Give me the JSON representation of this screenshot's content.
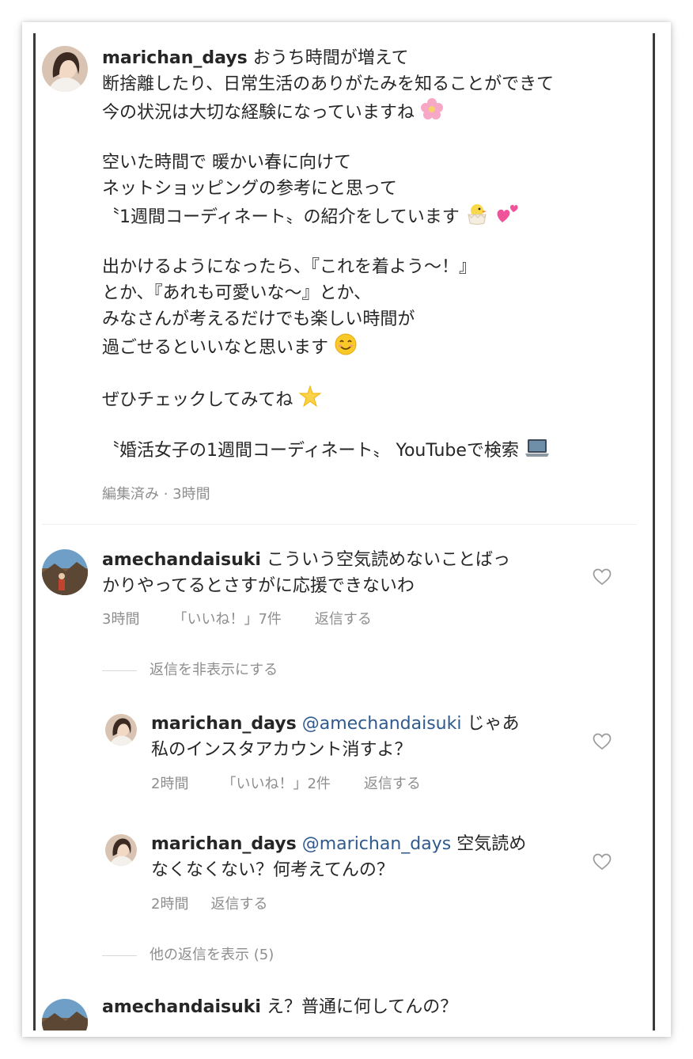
{
  "post": {
    "username": "marichan_days",
    "lines": [
      "おうち時間が増えて",
      "断捨離したり、日常生活のありがたみを知ることができて",
      "今の状況は大切な経験になっていますね",
      "",
      "空いた時間で 暖かい春に向けて",
      "ネットショッピングの参考にと思って",
      "〝1週間コーディネート〟の紹介をしています",
      "",
      "出かけるようになったら、『これを着よう〜！』",
      "とか、『あれも可愛いな〜』とか、",
      "みなさんが考えるだけでも楽しい時間が",
      "過ごせるといいなと思います",
      "",
      "ぜひチェックしてみてね",
      "",
      " 〝婚活女子の1週間コーディネート〟 YouTubeで検索"
    ],
    "meta": "編集済み · 3時間"
  },
  "comment1": {
    "username": "amechandaisuki",
    "line1": "こういう空気読めないことばっ",
    "line2": "かりやってるとさすがに応援できないわ",
    "time": "3時間",
    "likes": "「いいね！」7件",
    "reply": "返信する"
  },
  "hide_replies": "返信を非表示にする",
  "reply1": {
    "username": "marichan_days",
    "mention": "@amechandaisuki",
    "line1_rest": " じゃあ",
    "line2": "私のインスタアカウント消すよ？",
    "time": "2時間",
    "likes": "「いいね！」2件",
    "reply": "返信する"
  },
  "reply2": {
    "username": "marichan_days",
    "mention": "@marichan_days",
    "line1_rest": " 空気読め",
    "line2": "なくなくない？何考えてんの？",
    "time": "2時間",
    "reply": "返信する"
  },
  "more_replies": "他の返信を表示 (5)",
  "comment2": {
    "username": "amechandaisuki",
    "line1": "え？普通に何してんの？"
  },
  "icons": {
    "heart": "heart-outline-icon",
    "emoji_flower": "cherry-blossom-emoji",
    "emoji_chick": "hatching-chick-emoji",
    "emoji_hearts": "two-hearts-emoji",
    "emoji_smile": "smiling-face-emoji",
    "emoji_sparkle": "glowing-star-emoji",
    "emoji_laptop": "laptop-emoji"
  },
  "colors": {
    "text": "#262626",
    "meta": "#8e8e8e",
    "mention": "#2f5a8d",
    "frame_border": "#3a3a3a"
  }
}
